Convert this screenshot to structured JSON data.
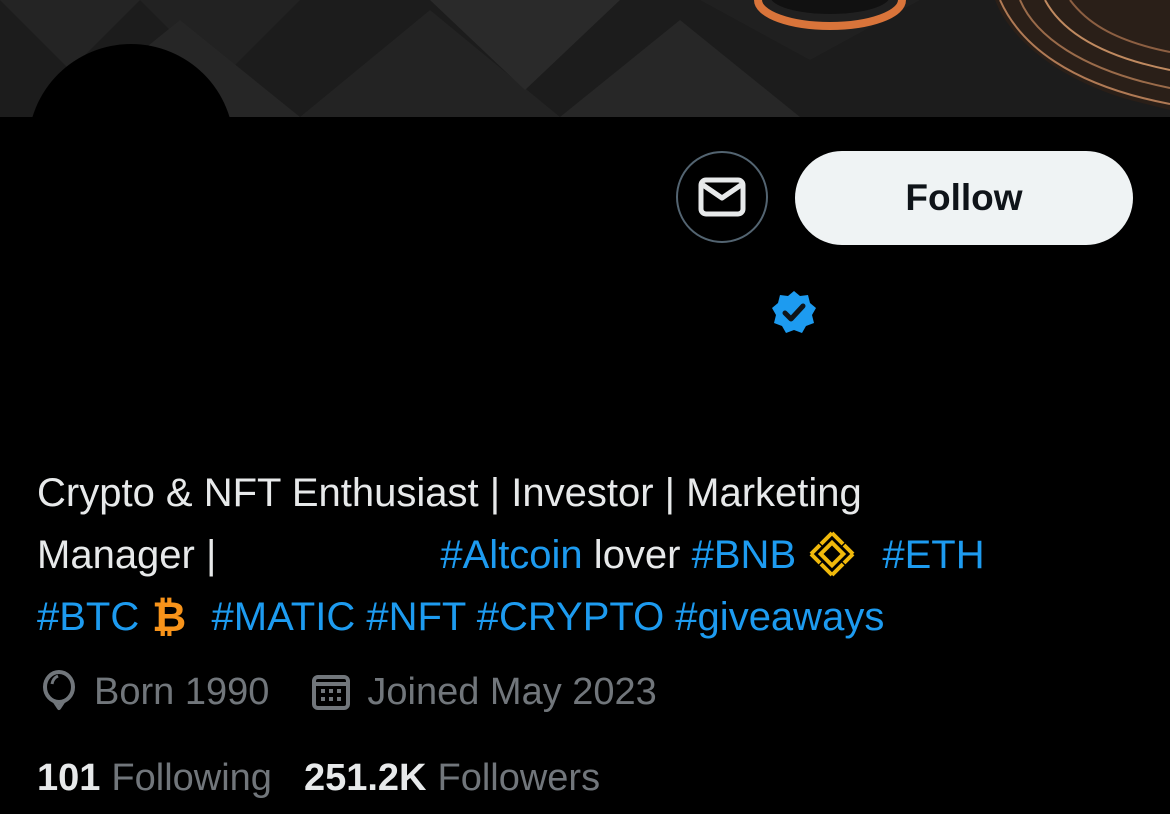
{
  "profile": {
    "follow_label": "Follow",
    "bio": {
      "line1": "Crypto & NFT Enthusiast | Investor | Marketing",
      "line2_text": "Manager |",
      "tag_altcoin": "#Altcoin",
      "word_lover": " lover ",
      "tag_bnb": "#BNB",
      "tag_eth": "#ETH",
      "tag_btc": "#BTC",
      "tags_rest": "#MATIC #NFT #CRYPTO #giveaways"
    },
    "born": "Born 1990",
    "joined": "Joined May 2023",
    "following_count": "101",
    "following_label": "Following",
    "followers_count": "251.2K",
    "followers_label": "Followers"
  },
  "icons": {
    "message": "envelope-icon",
    "verified": "verified-badge-icon",
    "bnb": "bnb-coin-icon",
    "btc": "bitcoin-icon",
    "birthday": "balloon-icon",
    "joined": "calendar-icon"
  },
  "colors": {
    "link": "#1d9bf0",
    "muted": "#71767b",
    "follow_bg": "#eff3f4",
    "bnb_gold": "#f0b90b",
    "btc_orange": "#f7931a"
  }
}
